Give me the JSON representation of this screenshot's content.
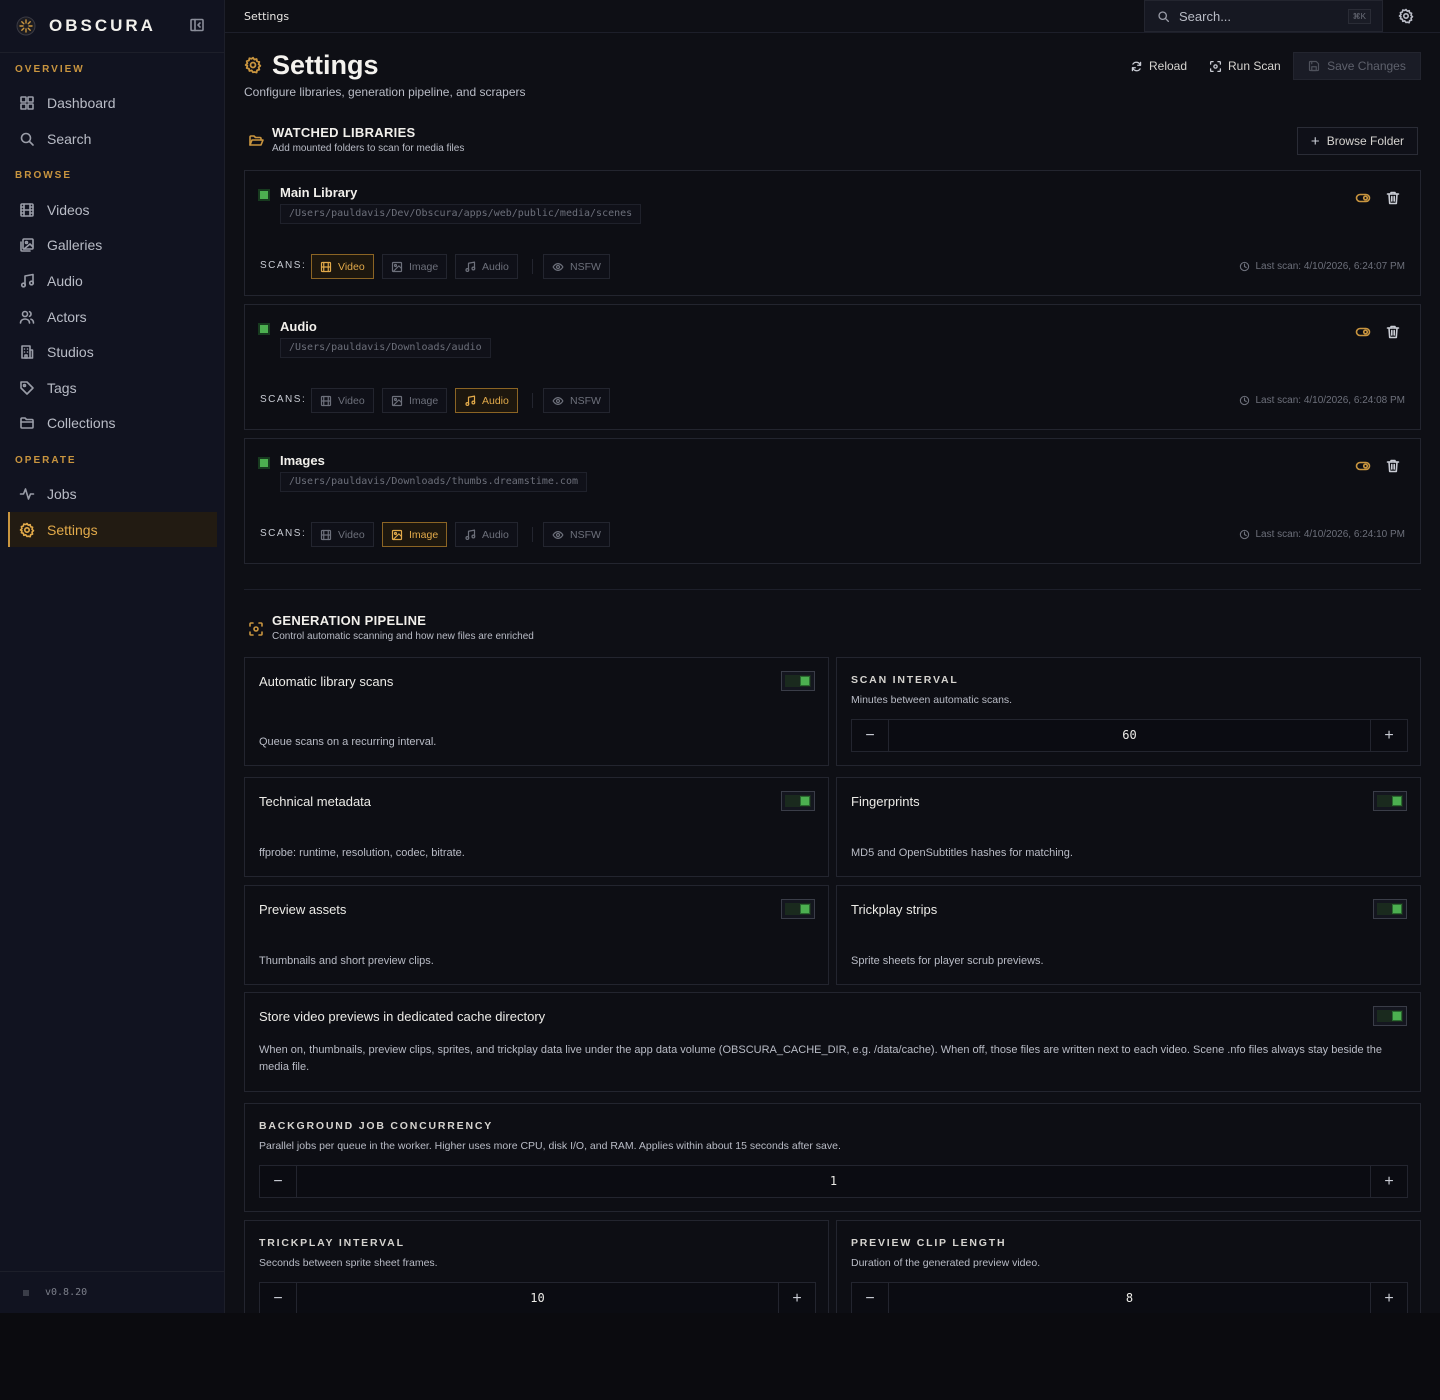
{
  "brand": {
    "name": "OBSCURA"
  },
  "sidebar": {
    "sections": [
      {
        "label": "OVERVIEW"
      },
      {
        "label": "BROWSE"
      },
      {
        "label": "OPERATE"
      }
    ],
    "items": [
      {
        "label": "Dashboard",
        "icon": "dashboard-icon"
      },
      {
        "label": "Search",
        "icon": "search-icon"
      },
      {
        "label": "Videos",
        "icon": "film-icon"
      },
      {
        "label": "Galleries",
        "icon": "gallery-icon"
      },
      {
        "label": "Audio",
        "icon": "music-icon"
      },
      {
        "label": "Actors",
        "icon": "users-icon"
      },
      {
        "label": "Studios",
        "icon": "building-icon"
      },
      {
        "label": "Tags",
        "icon": "tag-icon"
      },
      {
        "label": "Collections",
        "icon": "folder-icon"
      },
      {
        "label": "Jobs",
        "icon": "activity-icon"
      },
      {
        "label": "Settings",
        "icon": "gear-icon",
        "active": true
      }
    ],
    "version": "v0.8.20"
  },
  "topbar": {
    "breadcrumb": "Settings",
    "search_placeholder": "Search...",
    "search_shortcut": "⌘K"
  },
  "header": {
    "title": "Settings",
    "subtitle": "Configure libraries, generation pipeline, and scrapers",
    "reload_label": "Reload",
    "run_scan_label": "Run Scan",
    "save_label": "Save Changes"
  },
  "libraries": {
    "title": "WATCHED LIBRARIES",
    "subtitle": "Add mounted folders to scan for media files",
    "browse_label": "Browse Folder",
    "scans_label": "SCANS:",
    "chip_labels": {
      "video": "Video",
      "image": "Image",
      "audio": "Audio",
      "nsfw": "NSFW"
    },
    "items": [
      {
        "name": "Main Library",
        "path": "/Users/pauldavis/Dev/Obscura/apps/web/public/media/scenes",
        "active_scan": "video",
        "last_scan": "Last scan: 4/10/2026, 6:24:07 PM"
      },
      {
        "name": "Audio",
        "path": "/Users/pauldavis/Downloads/audio",
        "active_scan": "audio",
        "last_scan": "Last scan: 4/10/2026, 6:24:08 PM"
      },
      {
        "name": "Images",
        "path": "/Users/pauldavis/Downloads/thumbs.dreamstime.com",
        "active_scan": "image",
        "last_scan": "Last scan: 4/10/2026, 6:24:10 PM"
      }
    ]
  },
  "pipeline": {
    "title": "GENERATION PIPELINE",
    "subtitle": "Control automatic scanning and how new files are enriched",
    "auto_scans": {
      "title": "Automatic library scans",
      "desc": "Queue scans on a recurring interval.",
      "enabled": true
    },
    "scan_interval": {
      "label": "SCAN INTERVAL",
      "desc": "Minutes between automatic scans.",
      "value": "60"
    },
    "technical_metadata": {
      "title": "Technical metadata",
      "desc": "ffprobe: runtime, resolution, codec, bitrate.",
      "enabled": true
    },
    "fingerprints": {
      "title": "Fingerprints",
      "desc": "MD5 and OpenSubtitles hashes for matching.",
      "enabled": true
    },
    "preview_assets": {
      "title": "Preview assets",
      "desc": "Thumbnails and short preview clips.",
      "enabled": true
    },
    "trickplay_strips": {
      "title": "Trickplay strips",
      "desc": "Sprite sheets for player scrub previews.",
      "enabled": true
    },
    "cache_dir": {
      "title": "Store video previews in dedicated cache directory",
      "desc": "When on, thumbnails, preview clips, sprites, and trickplay data live under the app data volume (OBSCURA_CACHE_DIR, e.g. /data/cache). When off, those files are written next to each video. Scene .nfo files always stay beside the media file.",
      "enabled": true
    },
    "concurrency": {
      "label": "BACKGROUND JOB CONCURRENCY",
      "desc": "Parallel jobs per queue in the worker. Higher uses more CPU, disk I/O, and RAM. Applies within about 15 seconds after save.",
      "value": "1"
    },
    "trickplay_interval": {
      "label": "TRICKPLAY INTERVAL",
      "desc": "Seconds between sprite sheet frames.",
      "value": "10"
    },
    "preview_clip_length": {
      "label": "PREVIEW CLIP LENGTH",
      "desc": "Duration of the generated preview video.",
      "value": "8"
    }
  },
  "colors": {
    "accent": "#c9953f",
    "success": "#4caf50",
    "background": "#0e0f15",
    "sidebar": "#111320"
  }
}
